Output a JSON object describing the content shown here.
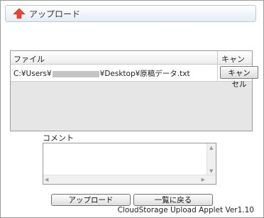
{
  "header": {
    "title": "アップロード",
    "icon": "upload-arrow-icon"
  },
  "table": {
    "columns": [
      "ファイル",
      "キャンセル"
    ],
    "rows": [
      {
        "path_prefix": "C:¥Users¥",
        "path_suffix": "¥Desktop¥原稿データ.txt",
        "cancel_label": "キャンセル"
      }
    ]
  },
  "comment": {
    "label": "コメント",
    "value": ""
  },
  "buttons": {
    "upload": "アップロード",
    "back": "一覧に戻る"
  },
  "footer": {
    "version": "CloudStorage Upload Applet Ver1.10"
  },
  "colors": {
    "accent": "#e8442f"
  }
}
